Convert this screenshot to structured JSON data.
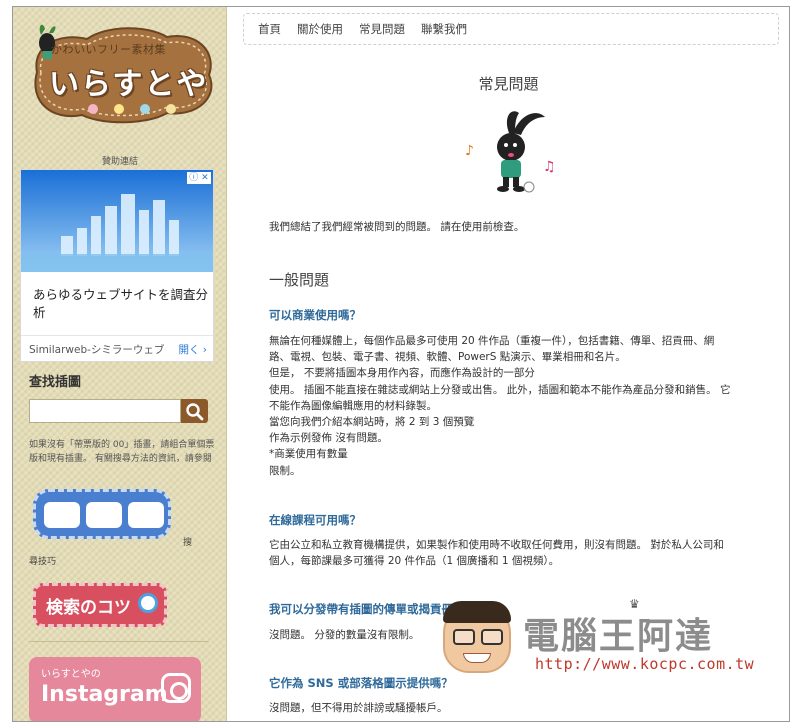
{
  "logo": {
    "subtitle": "かわいいフリー素材集",
    "title": "いらすとや"
  },
  "sidebar": {
    "sponsor_label": "贊助連結",
    "ad": {
      "close_label": "ⓘ ✕",
      "text": "あらゆるウェブサイトを調査分析",
      "advertiser": "Similarweb-シミラーウェブ",
      "open_label": "開く ›"
    },
    "search_heading": "查找插圖",
    "search_placeholder": "",
    "search_note": "如果沒有「帶票版的 00」插畫，請組合單個票版和現有插畫。 有關搜尋方法的資訊，請參閱",
    "search_tips_side": "搜",
    "search_tips_label": "尋技巧",
    "tips_button": "検索のコツ",
    "instagram_sub": "いらすとやの",
    "instagram_main": "Instagram"
  },
  "nav": {
    "items": [
      "首頁",
      "關於使用",
      "常見問題",
      "聯繫我們"
    ]
  },
  "main": {
    "page_title": "常見問題",
    "intro": "我們總結了我們經常被問到的問題。 請在使用前檢查。",
    "section_title": "一般問題",
    "faq": [
      {
        "question": "可以商業使用嗎？",
        "answer_lines": [
          "無論在何種媒體上，每個作品最多可使用 20 件作品（重複一件），包括書籍、傳單、招貢冊、網",
          "路、電視、包裝、電子書、視頻、軟體、PowerS 點演示、畢業相冊和名片。",
          "但是， 不要將插圖本身用作內容，而應作為設計的一部分",
          "使用。 插圖不能直接在雜誌或網站上分發或出售。 此外，插圖和範本不能作為產品分發和銷售。 它",
          "不能作為圖像編輯應用的材料錄製。",
          "當您向我們介紹本網站時，將 2 到 3 個預覽",
          "作為示例發佈 沒有問題。",
          "*商業使用有數量",
          "限制。"
        ]
      },
      {
        "question": "在線課程可用嗎？",
        "answer_lines": [
          "它由公立和私立教育機構提供，如果製作和使用時不收取任何費用，則沒有問題。 對於私人公司和",
          "個人，每節課最多可獲得 20 件作品（1 個廣播和 1 個視頻）。"
        ]
      },
      {
        "question": "我可以分發帶有插圖的傳單或揭貢冊嗎？",
        "answer_lines": [
          "沒問題。 分發的數量沒有限制。"
        ]
      },
      {
        "question": "它作為 SNS 或部落格圖示提供嗎？",
        "answer_lines": [
          "沒問題，但不得用於誹謗或騷擾帳戶。"
        ]
      }
    ]
  },
  "watermark": {
    "title": "電腦王阿達",
    "url": "http://www.kocpc.com.tw"
  },
  "colors": {
    "sidebar_bg": "#e3dcb6",
    "question_blue": "#2f6a9a",
    "search_button": "#8c5a2a",
    "tips_pink": "#d8505f",
    "instagram_pink": "#e6889c",
    "watermark_url_red": "#c0392b"
  }
}
